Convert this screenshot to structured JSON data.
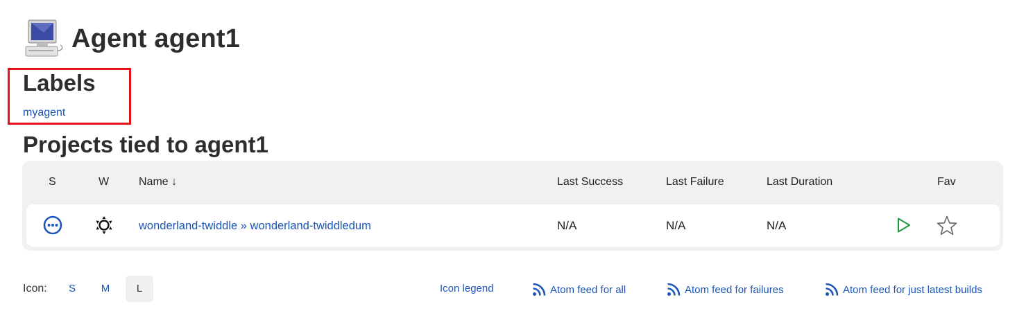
{
  "header": {
    "title": "Agent agent1",
    "icon": "computer-icon"
  },
  "labels": {
    "title": "Labels",
    "items": [
      "myagent"
    ]
  },
  "projects": {
    "title": "Projects tied to agent1",
    "columns": {
      "s": "S",
      "w": "W",
      "name": "Name  ↓",
      "last_success": "Last Success",
      "last_failure": "Last Failure",
      "last_duration": "Last Duration",
      "fav": "Fav"
    },
    "rows": [
      {
        "status_icon": "in-progress-icon",
        "weather_icon": "sun-icon",
        "parent": "wonderland-twiddle",
        "separator": "»",
        "name": "wonderland-twiddledum",
        "last_success": "N/A",
        "last_failure": "N/A",
        "last_duration": "N/A",
        "run_icon": "play-icon",
        "fav_icon": "star-icon"
      }
    ]
  },
  "footer": {
    "icon_label": "Icon:",
    "sizes": [
      "S",
      "M",
      "L"
    ],
    "active_size": "L",
    "icon_legend": "Icon legend",
    "feeds": [
      "Atom feed for all",
      "Atom feed for failures",
      "Atom feed for just latest builds"
    ]
  },
  "colors": {
    "link": "#1b55b8",
    "highlight_box": "#e5141b",
    "run_green": "#1a9a3a",
    "status_blue": "#1b55b8"
  }
}
